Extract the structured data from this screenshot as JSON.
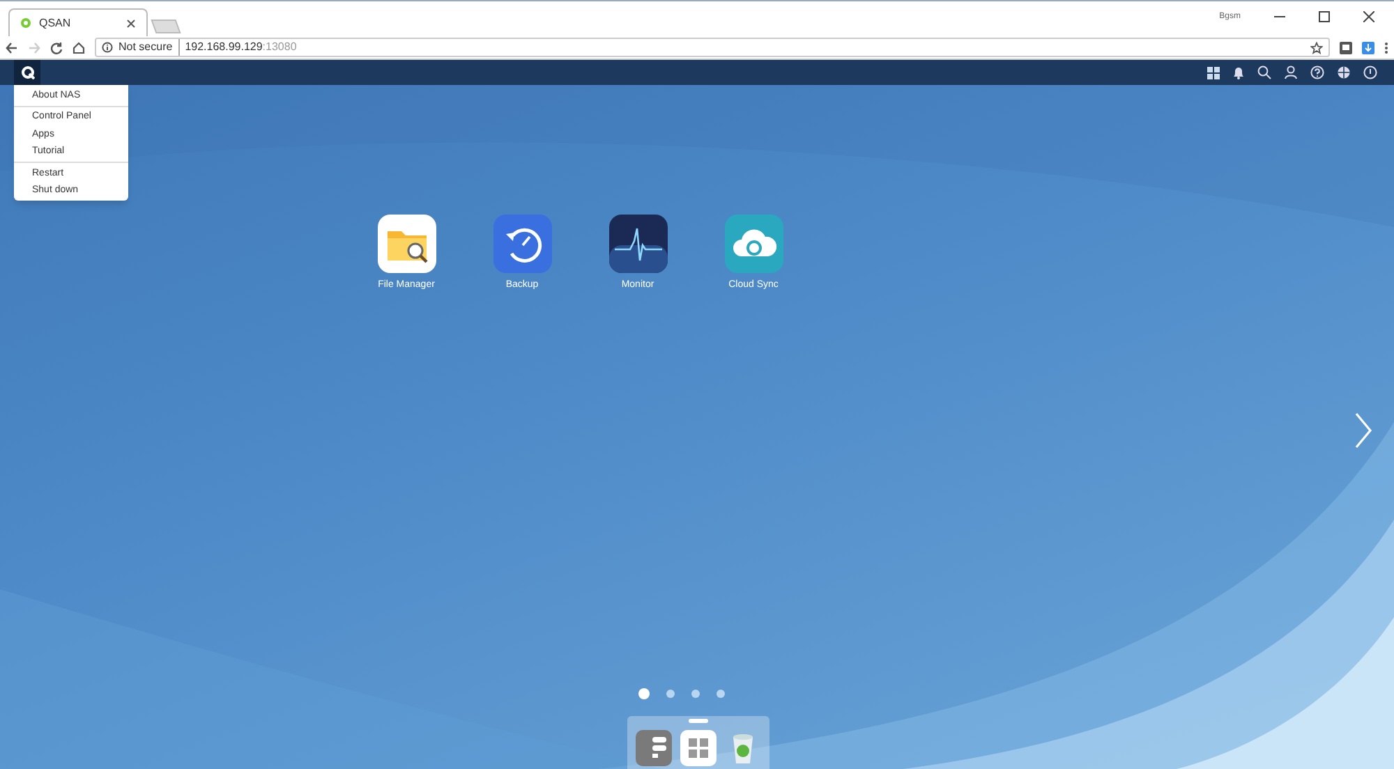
{
  "browser": {
    "tab_title": "QSAN",
    "user": "Bgsm",
    "security": "Not secure",
    "url_host": "192.168.99.129",
    "url_port": ":13080"
  },
  "menu": {
    "sections": [
      {
        "items": [
          "About NAS"
        ]
      },
      {
        "items": [
          "Control Panel",
          "Apps",
          "Tutorial"
        ]
      },
      {
        "items": [
          "Restart",
          "Shut down"
        ]
      }
    ]
  },
  "apps": [
    {
      "label": "File Manager",
      "kind": "files"
    },
    {
      "label": "Backup",
      "kind": "backup"
    },
    {
      "label": "Monitor",
      "kind": "monitor"
    },
    {
      "label": "Cloud Sync",
      "kind": "cloud"
    }
  ],
  "pages": [
    {
      "selected": true
    },
    {
      "selected": false
    },
    {
      "selected": false
    },
    {
      "selected": false
    }
  ],
  "dock": [
    {
      "kind": "storage",
      "selected": false
    },
    {
      "kind": "apps",
      "selected": true
    },
    {
      "kind": "trash",
      "selected": false
    }
  ]
}
